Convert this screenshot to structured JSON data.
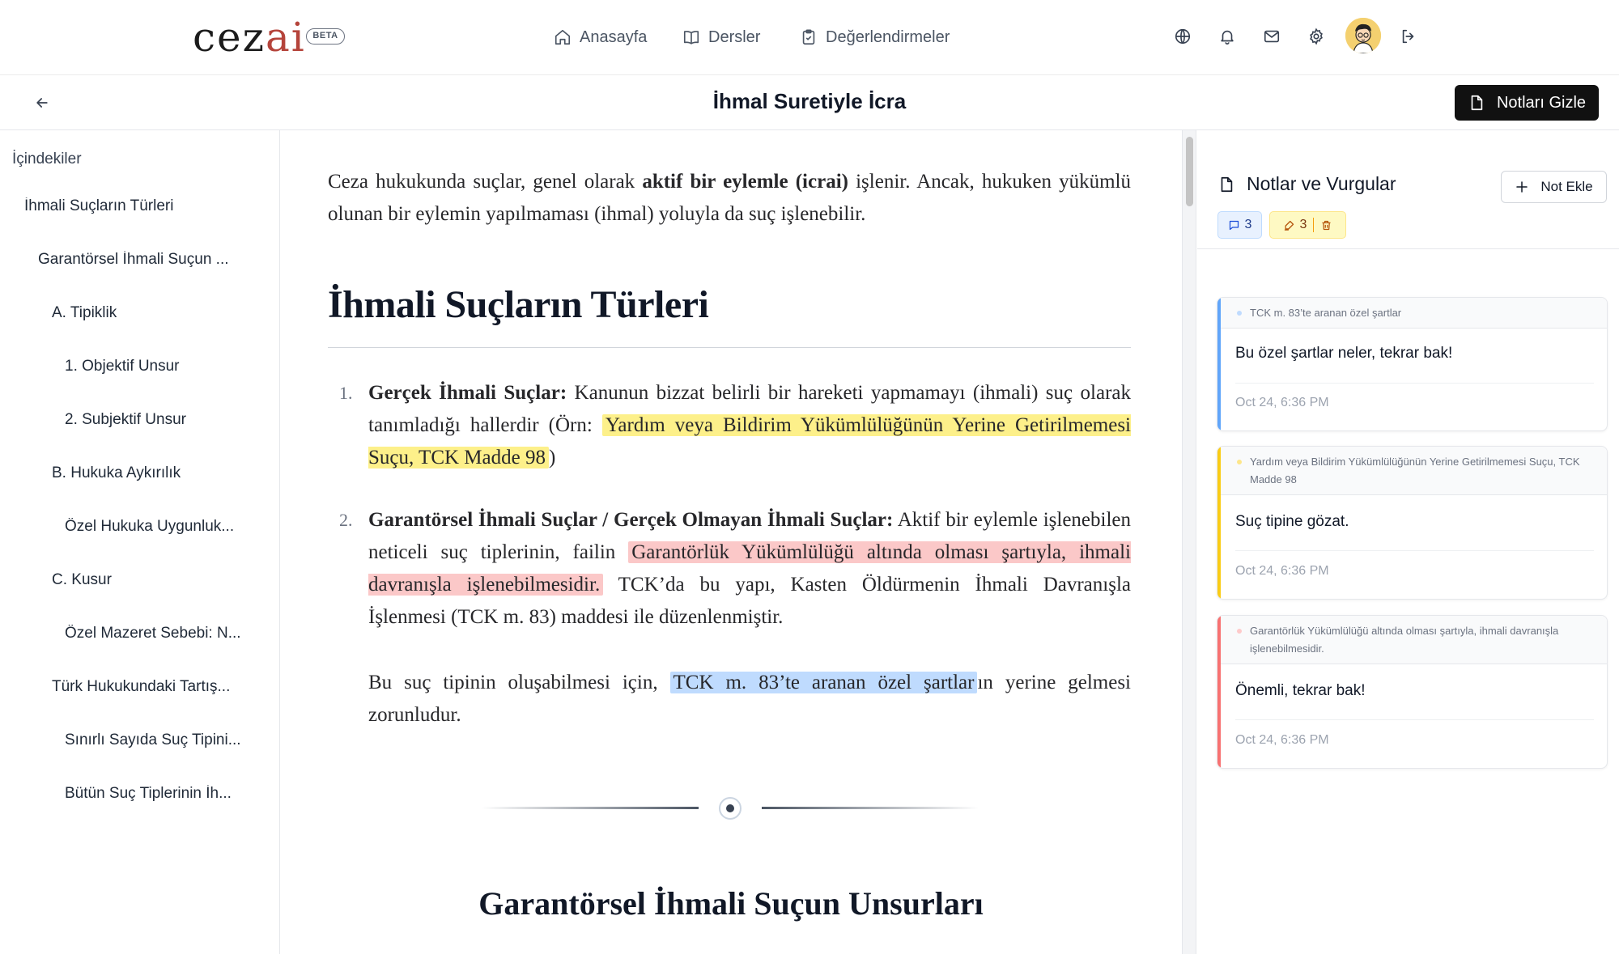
{
  "header": {
    "logo_main": "cez",
    "logo_accent": "ai",
    "beta": "BETA",
    "nav": [
      {
        "label": "Anasayfa",
        "icon": "home-icon"
      },
      {
        "label": "Dersler",
        "icon": "book-icon"
      },
      {
        "label": "Değerlendirmeler",
        "icon": "clipboard-icon"
      }
    ],
    "icons": [
      "globe-icon",
      "bell-icon",
      "mail-icon",
      "gear-icon",
      "avatar",
      "logout-icon"
    ]
  },
  "subheader": {
    "title": "İhmal Suretiyle İcra",
    "hide_notes": "Notları Gizle"
  },
  "toc": {
    "title": "İçindekiler",
    "items": [
      {
        "label": "İhmali Suçların Türleri",
        "level": 1
      },
      {
        "label": "Garantörsel İhmali Suçun ...",
        "level": 2
      },
      {
        "label": "A. Tipiklik",
        "level": 3
      },
      {
        "label": "1. Objektif Unsur",
        "level": 4
      },
      {
        "label": "2. Subjektif Unsur",
        "level": 4
      },
      {
        "label": "B. Hukuka Aykırılık",
        "level": 3
      },
      {
        "label": "Özel Hukuka Uygunluk...",
        "level": 4
      },
      {
        "label": "C. Kusur",
        "level": 3
      },
      {
        "label": "Özel Mazeret Sebebi: N...",
        "level": 4
      },
      {
        "label": "Türk Hukukundaki Tartış...",
        "level": 3
      },
      {
        "label": "Sınırlı Sayıda Suç Tipini...",
        "level": 4
      },
      {
        "label": "Bütün Suç Tiplerinin İh...",
        "level": 4
      }
    ]
  },
  "content": {
    "intro_a": "Ceza hukukunda suçlar, genel olarak ",
    "intro_b": "aktif bir eylemle (icrai)",
    "intro_c": " işlenir. Ancak, hukuken yükümlü olunan bir eylemin yapılmaması (ihmal) yoluyla da suç işlenebilir.",
    "h1": "İhmali Suçların Türleri",
    "li1_num": "1.",
    "li1_bold": "Gerçek İhmali Suçlar:",
    "li1_text": " Kanunun bizzat belirli bir hareketi yapmamayı (ihmali) suç olarak tanımladığı hallerdir (Örn: ",
    "li1_hl": "Yardım veya Bildirim Yükümlülüğünün Yerine Getirilmemesi Suçu, TCK Madde 98",
    "li1_end": ")",
    "li2_num": "2.",
    "li2_bold": "Garantörsel İhmali Suçlar / Gerçek Olmayan İhmali Suçlar:",
    "li2_text": " Aktif bir eylemle işlenebilen neticeli suç tiplerinin, failin ",
    "li2_hl": "Garantörlük Yükümlülüğü altında olması şartıyla, ihmali davranışla işlenebilmesidir.",
    "li2_end": " TCK’da bu yapı, Kasten Öldürmenin İhmali Davranışla İşlenmesi (TCK m. 83) maddesi ile düzenlenmiştir.",
    "p3_a": "Bu suç tipinin oluşabilmesi için, ",
    "p3_hl": "TCK m. 83’te aranan özel şartlar",
    "p3_b": "ın yerine gelmesi zorunludur.",
    "h2": "Garantörsel İhmali Suçun Unsurları"
  },
  "notes": {
    "title": "Notlar ve Vurgular",
    "add_label": "Not Ekle",
    "comment_count": "3",
    "highlight_count": "3",
    "cards": [
      {
        "quote": "TCK m. 83’te aranan özel şartlar",
        "text": "Bu özel şartlar neler, tekrar bak!",
        "date": "Oct 24, 6:36 PM",
        "color": "#60a5fa"
      },
      {
        "quote": "Yardım veya Bildirim Yükümlülüğünün Yerine Getirilmemesi Suçu, TCK Madde 98",
        "text": "Suç tipine gözat.",
        "date": "Oct 24, 6:36 PM",
        "color": "#facc15"
      },
      {
        "quote": "Garantörlük Yükümlülüğü altında olması şartıyla, ihmali davranışla işlenebilmesidir.",
        "text": "Önemli, tekrar bak!",
        "date": "Oct 24, 6:36 PM",
        "color": "#f87171"
      }
    ]
  }
}
